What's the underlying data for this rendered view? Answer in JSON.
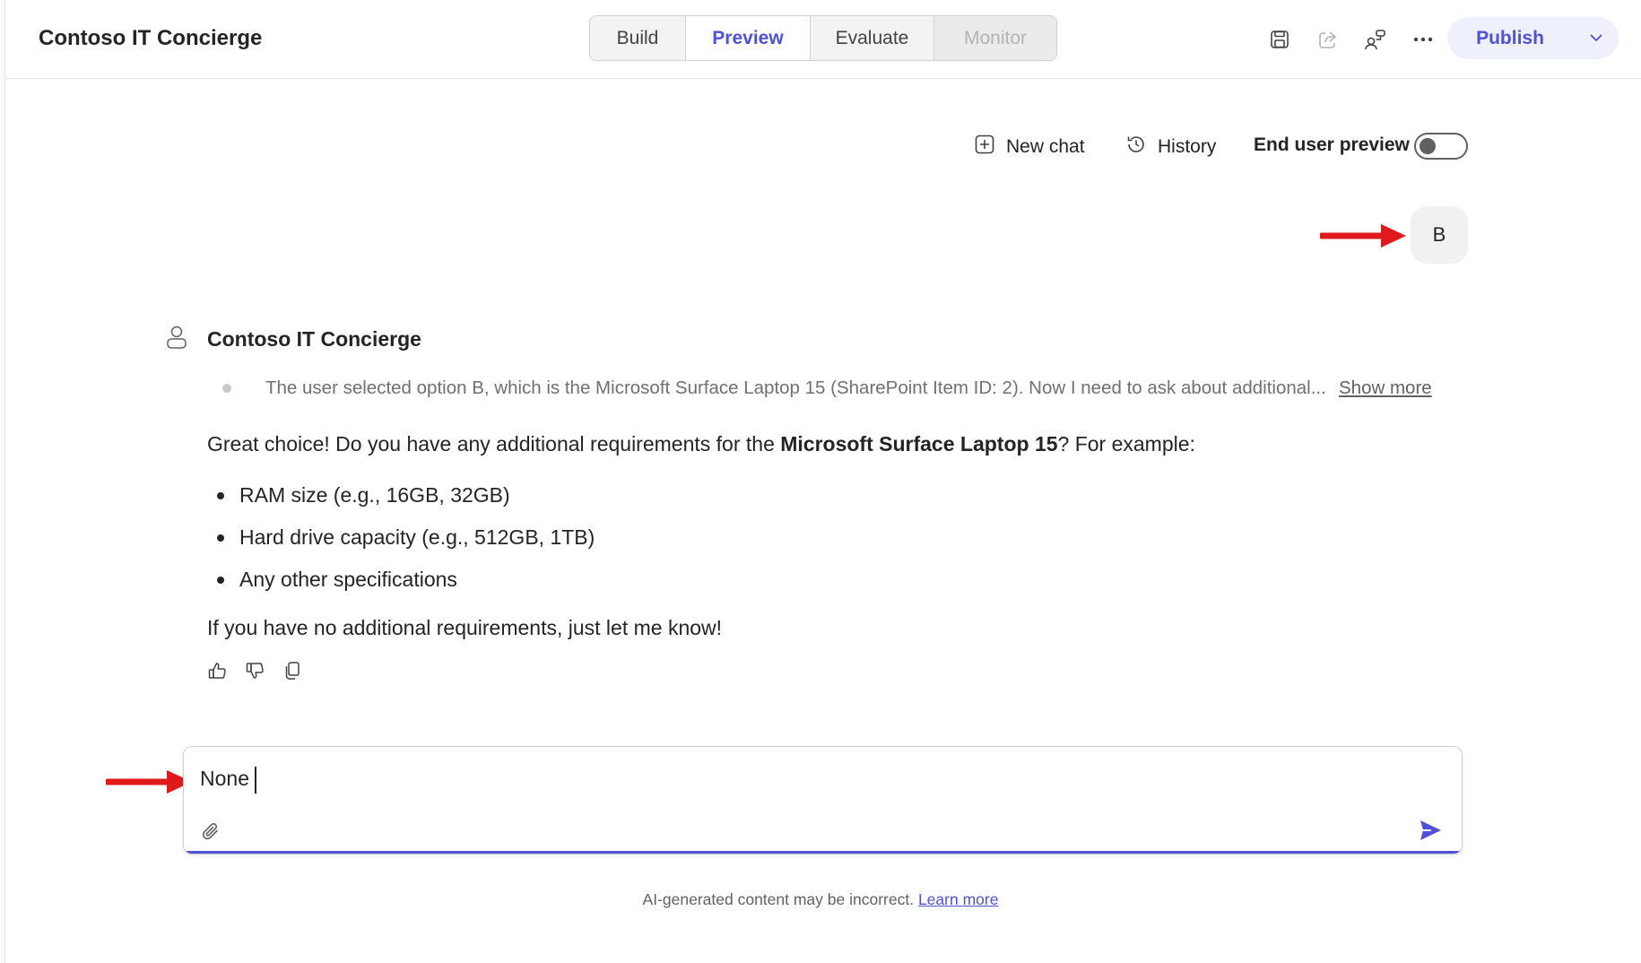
{
  "app": {
    "title": "Contoso IT Concierge"
  },
  "tabs": [
    {
      "label": "Build",
      "state": "normal"
    },
    {
      "label": "Preview",
      "state": "active"
    },
    {
      "label": "Evaluate",
      "state": "normal"
    },
    {
      "label": "Monitor",
      "state": "disabled"
    }
  ],
  "header_actions": {
    "icons": [
      "save-icon",
      "share-icon",
      "connections-icon",
      "more-icon"
    ],
    "publish_label": "Publish"
  },
  "toolbar": {
    "new_chat_label": "New chat",
    "history_label": "History",
    "end_user_preview_label": "End user preview",
    "end_user_preview_on": false
  },
  "conversation": {
    "user_message": "B",
    "bot": {
      "name": "Contoso IT Concierge",
      "reasoning": "The user selected option B, which is the Microsoft Surface Laptop 15 (SharePoint Item ID: 2). Now I need to ask about additional...",
      "show_more_label": "Show more",
      "intro_before": "Great choice! Do you have any additional requirements for the ",
      "intro_bold": "Microsoft Surface Laptop 15",
      "intro_after": "? For example:",
      "bullets": [
        "RAM size (e.g., 16GB, 32GB)",
        "Hard drive capacity (e.g., 512GB, 1TB)",
        "Any other specifications"
      ],
      "outro": "If you have no additional requirements, just let me know!",
      "reaction_icons": [
        "thumbs-up-icon",
        "thumbs-down-icon",
        "copy-icon"
      ]
    }
  },
  "composer": {
    "value": "None"
  },
  "footer": {
    "disclaimer": "AI-generated content may be incorrect.",
    "learn_more_label": "Learn more"
  },
  "colors": {
    "accent": "#4f52d6",
    "annotation_arrow": "#e0191c"
  }
}
